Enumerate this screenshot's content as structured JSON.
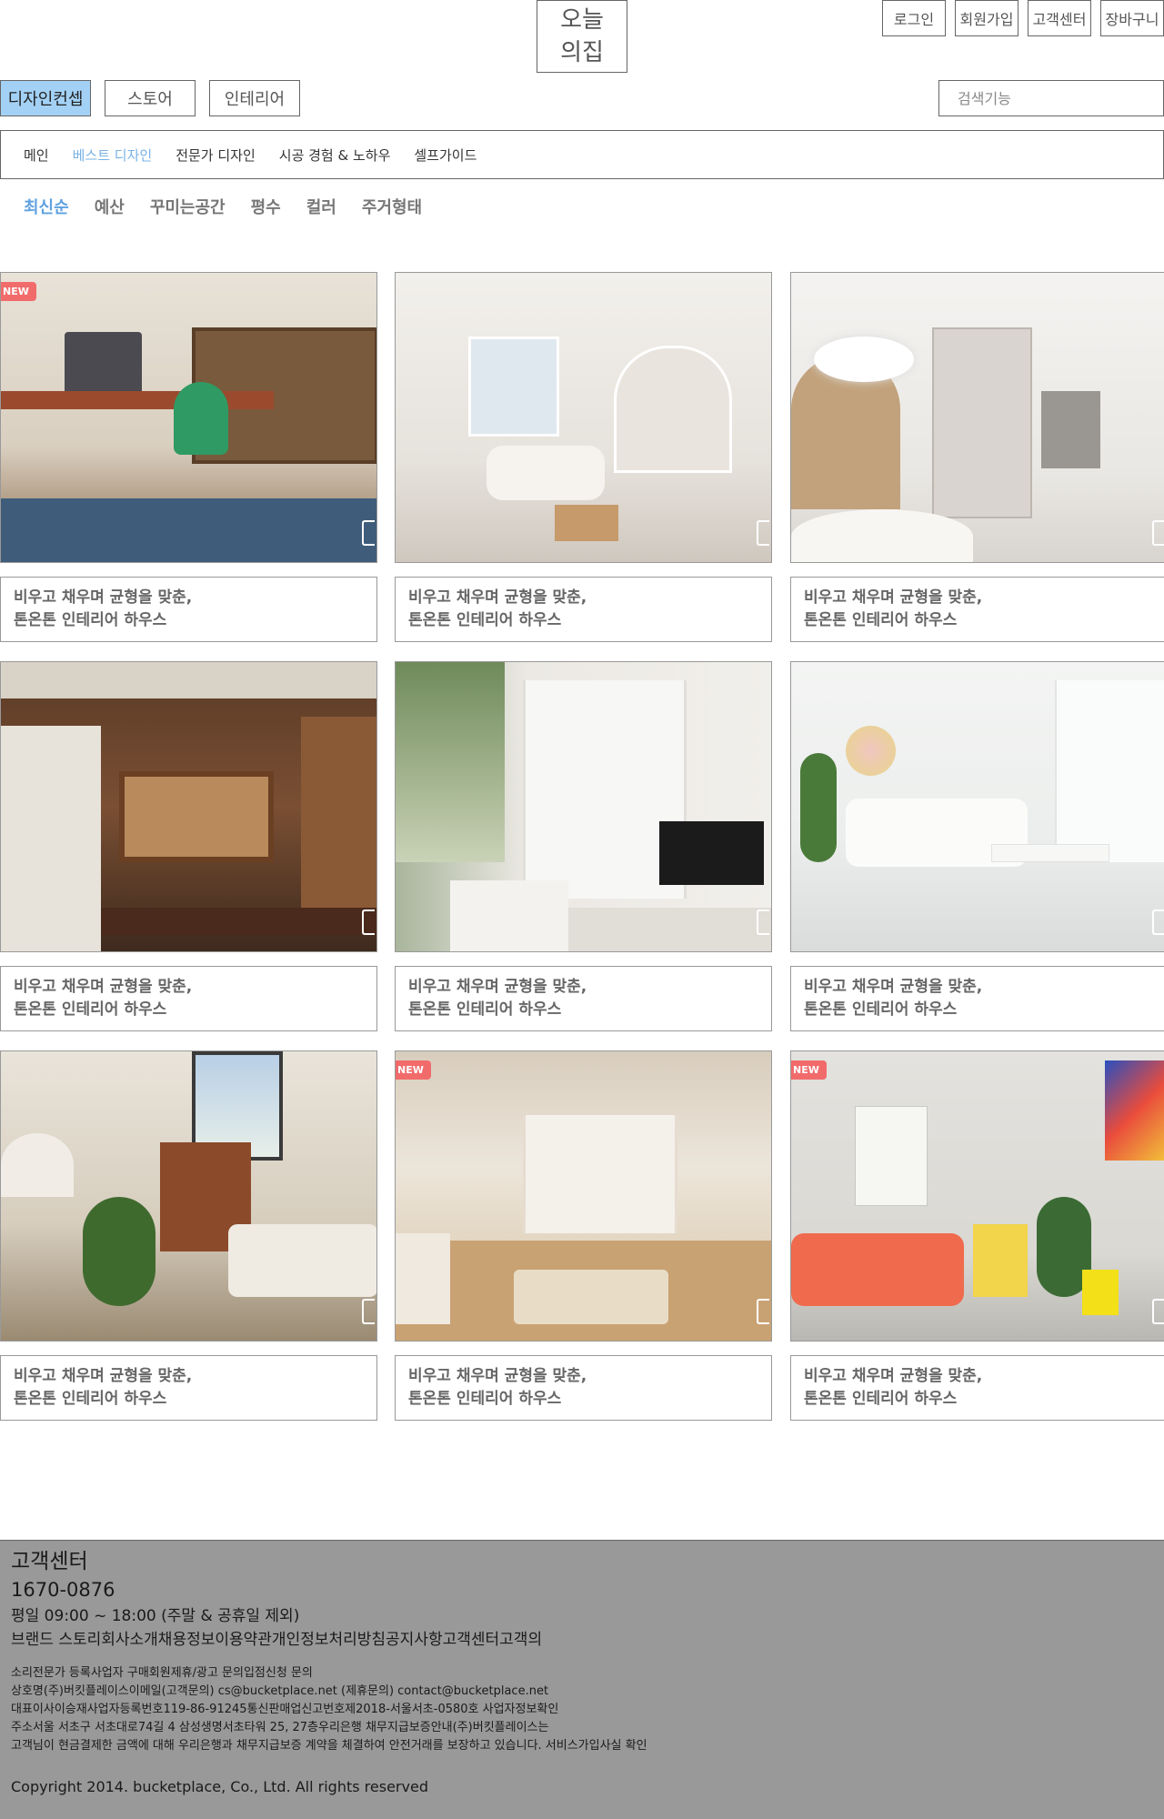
{
  "header": {
    "logo_line1": "오늘",
    "logo_line2": "의집",
    "top_links": {
      "login": "로그인",
      "signup": "회원가입",
      "customer_center": "고객센터",
      "cart": "장바구니"
    }
  },
  "main_tabs": {
    "design_concept": "디자인컨셉",
    "store": "스토어",
    "interior": "인테리어"
  },
  "search": {
    "placeholder": "검색기능"
  },
  "sub_nav": {
    "main": "메인",
    "best_design": "베스트 디자인",
    "expert_design": "전문가 디자인",
    "construction": "시공 경험 & 노하우",
    "self_guide": "셀프가이드"
  },
  "filters": {
    "latest": "최신순",
    "budget": "예산",
    "space": "꾸미는공간",
    "size": "평수",
    "color": "컬러",
    "housing": "주거형태"
  },
  "cards": [
    {
      "title1": "비우고 채우며 균형을 맞춘,",
      "title2": "톤온톤 인테리어 하우스",
      "badge": "NEW"
    },
    {
      "title1": "비우고 채우며 균형을 맞춘,",
      "title2": "톤온톤 인테리어 하우스"
    },
    {
      "title1": "비우고 채우며 균형을 맞춘,",
      "title2": "톤온톤 인테리어 하우스"
    },
    {
      "title1": "비우고 채우며 균형을 맞춘,",
      "title2": "톤온톤 인테리어 하우스"
    },
    {
      "title1": "비우고 채우며 균형을 맞춘,",
      "title2": "톤온톤 인테리어 하우스"
    },
    {
      "title1": "비우고 채우며 균형을 맞춘,",
      "title2": "톤온톤 인테리어 하우스"
    },
    {
      "title1": "비우고 채우며 균형을 맞춘,",
      "title2": "톤온톤 인테리어 하우스"
    },
    {
      "title1": "비우고 채우며 균형을 맞춘,",
      "title2": "톤온톤 인테리어 하우스",
      "badge": "NEW"
    },
    {
      "title1": "비우고 채우며 균형을 맞춘,",
      "title2": "톤온톤 인테리어 하우스",
      "badge": "NEW"
    }
  ],
  "footer": {
    "title": "고객센터",
    "phone": "1670-0876",
    "hours": "평일 09:00 ~ 18:00 (주말 & 공휴일 제외)",
    "links": "브랜드 스토리회사소개채용정보이용약관개인정보처리방침공지사항고객센터고객의",
    "line1": "소리전문가 등록사업자 구매회원제휴/광고 문의입점신청 문의",
    "line2": "상호명(주)버킷플레이스이메일(고객문의) cs@bucketplace.net (제휴문의) contact@bucketplace.net",
    "line3": "대표이사이승재사업자등록번호119-86-91245통신판매업신고번호제2018-서울서초-0580호 사업자정보확인",
    "line4": "주소서울 서초구 서초대로74길 4 삼성생명서초타워 25, 27층우리은행 채무지급보증안내(주)버킷플레이스는",
    "line5": "고객님이 현금결제한  금액에 대해 우리은행과 채무지급보증 계약을 체결하여 안전거래를 보장하고 있습니다. 서비스가입사실 확인",
    "copyright": "Copyright 2014. bucketplace, Co., Ltd. All rights reserved"
  },
  "colors": {
    "active_tab": "#a3d1f5",
    "active_sub": "#7ab3e6",
    "active_filter": "#5fa2e0",
    "footer_bg": "#999999",
    "badge": "#f26b6b"
  }
}
